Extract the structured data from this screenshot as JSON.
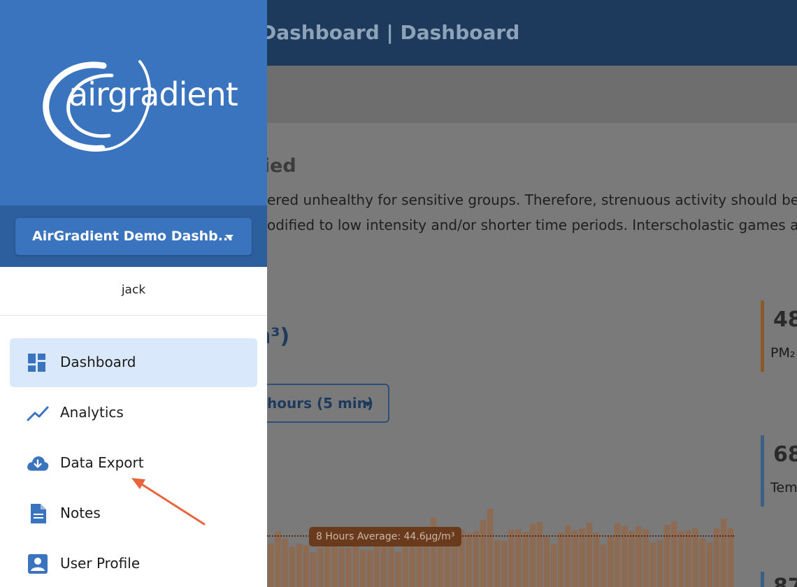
{
  "app": {
    "title": "Dashboard | Dashboard",
    "alert": {
      "title_partial": "fied",
      "line1": "ered unhealthy for sensitive groups. Therefore, strenuous activity should be red",
      "line2": "odified to low intensity and/or shorter time periods. Interscholastic games and"
    },
    "chart": {
      "title_partial": "n³)",
      "range_label": "hours (5 min)",
      "average_label": "8 Hours Average: 44.6µg/m³"
    },
    "kpis": [
      {
        "value": "48",
        "label": "PM₂"
      },
      {
        "value": "68",
        "label": "Tem"
      },
      {
        "value": "87",
        "label": ""
      }
    ]
  },
  "drawer": {
    "brand": "airgradient",
    "place": "AirGradient Demo Dashb...",
    "user": "jack",
    "nav": [
      {
        "label": "Dashboard",
        "icon": "dashboard-grid-icon",
        "active": true
      },
      {
        "label": "Analytics",
        "icon": "trend-line-icon",
        "active": false
      },
      {
        "label": "Data Export",
        "icon": "cloud-download-icon",
        "active": false
      },
      {
        "label": "Notes",
        "icon": "document-icon",
        "active": false
      },
      {
        "label": "User Profile",
        "icon": "user-badge-icon",
        "active": false
      }
    ]
  },
  "colors": {
    "drawer_header": "#3b74be",
    "place_strip": "#2d5f9f",
    "active_item": "#d9e8fb",
    "icon": "#3b74be",
    "annotation_arrow": "#e8643a",
    "topbar": "#1d3a5c"
  }
}
